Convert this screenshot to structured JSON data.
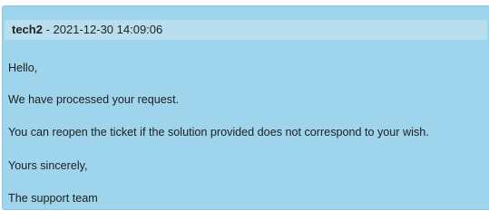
{
  "message": {
    "author": "tech2",
    "separator": " - ",
    "timestamp": "2021-12-30 14:09:06",
    "lines": [
      "Hello,",
      "We have processed your request.",
      "You can reopen the ticket if the solution provided does not correspond to your wish.",
      "Yours sincerely,",
      "The support team"
    ]
  },
  "colors": {
    "card_background": "#9ed5ec",
    "header_background": "#b9dfef",
    "text": "#202020"
  }
}
